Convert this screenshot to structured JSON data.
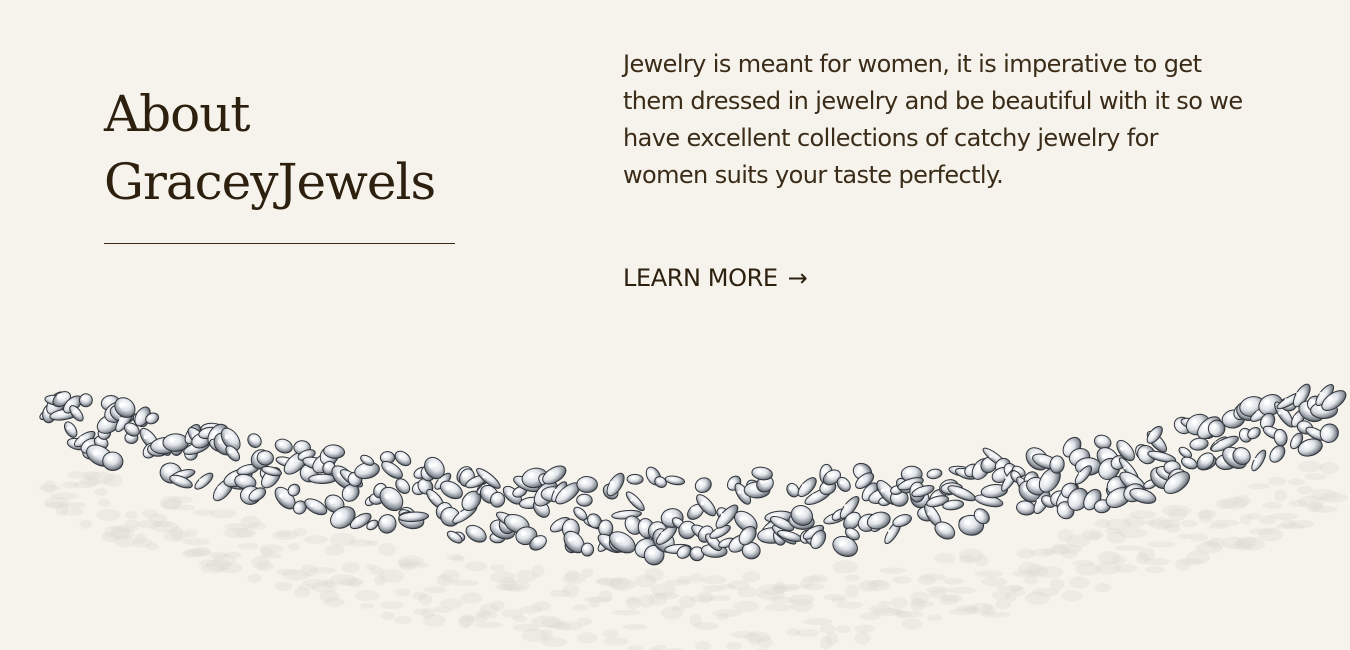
{
  "about": {
    "heading_line1": "About",
    "heading_line2": "GraceyJewels"
  },
  "description": {
    "line1": "Jewelry is meant for women, it is imperative to get",
    "line2": "them dressed in jewelry and be beautiful with it so we",
    "line3": "have excellent collections of catchy jewelry for",
    "line4": "women suits your taste perfectly."
  },
  "cta": {
    "label": "LEARN MORE",
    "arrow": "→"
  },
  "colors": {
    "background": "#f6f3ec",
    "heading": "#2d200e",
    "text": "#3a2c18"
  },
  "image": {
    "icon": "diamond-necklace-image"
  }
}
